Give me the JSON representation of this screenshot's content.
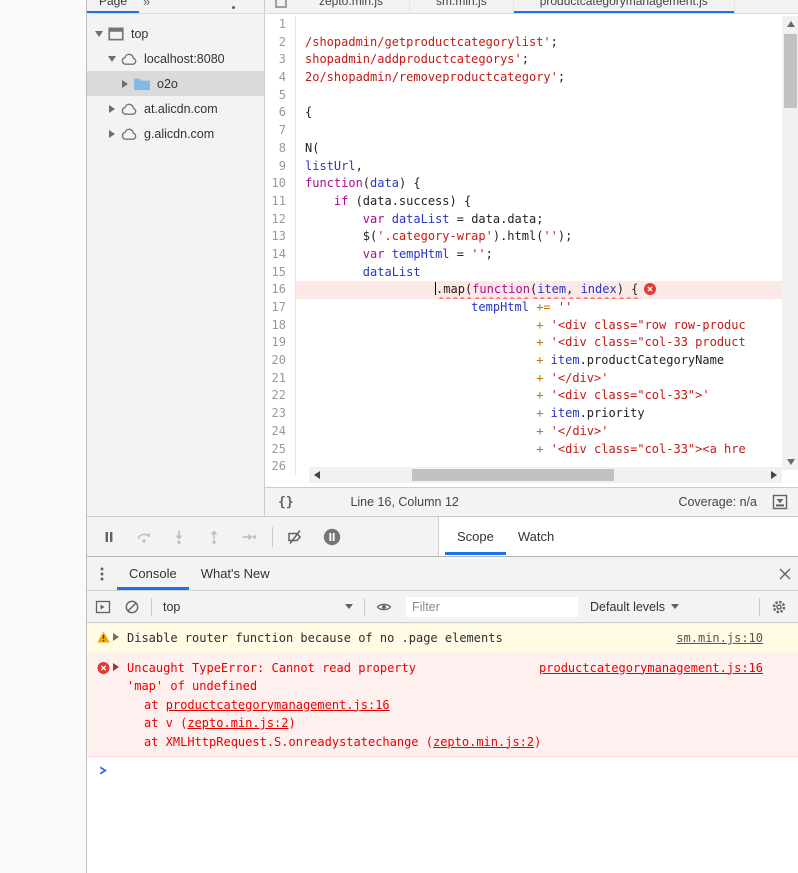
{
  "colors": {
    "accent_blue": "#1a73e8",
    "error_red": "#eb0000",
    "error_bg": "#fff0f0",
    "warning_bg": "#fffbe5",
    "selection_gray": "#dadada",
    "error_line_bg": "#fde8e8"
  },
  "navigator": {
    "tab_label": "Page",
    "overflow_label": "»",
    "more_icon": "kebab-menu-icon",
    "tree": [
      {
        "label": "top",
        "icon": "frame-icon",
        "arrow": "expanded",
        "depth": 0,
        "selected": false
      },
      {
        "label": "localhost:8080",
        "icon": "cloud-icon",
        "arrow": "expanded",
        "depth": 1,
        "selected": false
      },
      {
        "label": "o2o",
        "icon": "folder-icon",
        "arrow": "collapsed",
        "depth": 2,
        "selected": true
      },
      {
        "label": "at.alicdn.com",
        "icon": "cloud-icon",
        "arrow": "collapsed",
        "depth": 1,
        "selected": false
      },
      {
        "label": "g.alicdn.com",
        "icon": "cloud-icon",
        "arrow": "collapsed",
        "depth": 1,
        "selected": false
      }
    ]
  },
  "editor": {
    "tab_group_icon": "file-tab-icon",
    "tabs": [
      {
        "label": "zepto.min.js",
        "active": false
      },
      {
        "label": "sm.min.js",
        "active": false
      },
      {
        "label": "productcategorymanagement.js",
        "active": true
      }
    ],
    "status": {
      "pretty_print_label": "{}",
      "position": "Line 16, Column 12",
      "coverage": "Coverage: n/a",
      "drawer_icon": "expand-drawer-icon"
    },
    "code": {
      "lines": [
        {
          "n": 1,
          "seg": []
        },
        {
          "n": 2,
          "seg": [
            [
              "str",
              "/shopadmin/getproductcategorylist'"
            ],
            [
              "pln",
              ";"
            ]
          ]
        },
        {
          "n": 3,
          "seg": [
            [
              "str",
              "shopadmin/addproductcategorys'"
            ],
            [
              "pln",
              ";"
            ]
          ]
        },
        {
          "n": 4,
          "seg": [
            [
              "str",
              "2o/shopadmin/removeproductcategory'"
            ],
            [
              "pln",
              ";"
            ]
          ]
        },
        {
          "n": 5,
          "seg": []
        },
        {
          "n": 6,
          "seg": [
            [
              "pln",
              "{"
            ]
          ]
        },
        {
          "n": 7,
          "seg": []
        },
        {
          "n": 8,
          "seg": [
            [
              "pln",
              "N("
            ]
          ]
        },
        {
          "n": 9,
          "seg": [
            [
              "def",
              "listUrl"
            ],
            [
              "pln",
              ","
            ]
          ]
        },
        {
          "n": 10,
          "seg": [
            [
              "kw",
              "function"
            ],
            [
              "pln",
              "("
            ],
            [
              "def",
              "data"
            ],
            [
              "pln",
              ") {"
            ]
          ]
        },
        {
          "n": 11,
          "seg": [
            [
              "pln",
              "    "
            ],
            [
              "kw",
              "if"
            ],
            [
              "pln",
              " (data.success) {"
            ]
          ]
        },
        {
          "n": 12,
          "seg": [
            [
              "pln",
              "        "
            ],
            [
              "kw",
              "var"
            ],
            [
              "pln",
              " "
            ],
            [
              "def",
              "dataList"
            ],
            [
              "pln",
              " = data.data;"
            ]
          ]
        },
        {
          "n": 13,
          "seg": [
            [
              "pln",
              "        $("
            ],
            [
              "str",
              "'.category-wrap'"
            ],
            [
              "pln",
              ").html("
            ],
            [
              "str",
              "''"
            ],
            [
              "pln",
              ");"
            ]
          ]
        },
        {
          "n": 14,
          "seg": [
            [
              "pln",
              "        "
            ],
            [
              "kw",
              "var"
            ],
            [
              "pln",
              " "
            ],
            [
              "def",
              "tempHtml"
            ],
            [
              "pln",
              " = "
            ],
            [
              "str",
              "''"
            ],
            [
              "pln",
              ";"
            ]
          ]
        },
        {
          "n": 15,
          "seg": [
            [
              "pln",
              "        "
            ],
            [
              "def",
              "dataList"
            ]
          ]
        },
        {
          "n": 16,
          "error": true,
          "seg": [
            [
              "pln",
              "                  "
            ],
            [
              "caret",
              ""
            ],
            [
              "pln wavy",
              ".map("
            ],
            [
              "kw wavy",
              "function"
            ],
            [
              "pln wavy",
              "("
            ],
            [
              "def wavy",
              "item"
            ],
            [
              "pln wavy",
              ", "
            ],
            [
              "def wavy",
              "index"
            ],
            [
              "pln wavy",
              ") {"
            ],
            [
              "erricon",
              ""
            ]
          ]
        },
        {
          "n": 17,
          "seg": [
            [
              "pln",
              "                       "
            ],
            [
              "def",
              "tempHtml"
            ],
            [
              "pln",
              " "
            ],
            [
              "op",
              "+="
            ],
            [
              "pln",
              " "
            ],
            [
              "str",
              "''"
            ]
          ]
        },
        {
          "n": 18,
          "seg": [
            [
              "pln",
              "                                "
            ],
            [
              "op",
              "+"
            ],
            [
              "pln",
              " "
            ],
            [
              "str",
              "'<div class=\"row row-produc"
            ]
          ]
        },
        {
          "n": 19,
          "seg": [
            [
              "pln",
              "                                "
            ],
            [
              "op",
              "+"
            ],
            [
              "pln",
              " "
            ],
            [
              "str",
              "'<div class=\"col-33 product"
            ]
          ]
        },
        {
          "n": 20,
          "seg": [
            [
              "pln",
              "                                "
            ],
            [
              "op",
              "+"
            ],
            [
              "pln",
              " "
            ],
            [
              "def",
              "item"
            ],
            [
              "pln",
              ".productCategoryName"
            ]
          ]
        },
        {
          "n": 21,
          "seg": [
            [
              "pln",
              "                                "
            ],
            [
              "op",
              "+"
            ],
            [
              "pln",
              " "
            ],
            [
              "str",
              "'</div>'"
            ]
          ]
        },
        {
          "n": 22,
          "seg": [
            [
              "pln",
              "                                "
            ],
            [
              "op",
              "+"
            ],
            [
              "pln",
              " "
            ],
            [
              "str",
              "'<div class=\"col-33\">'"
            ]
          ]
        },
        {
          "n": 23,
          "seg": [
            [
              "pln",
              "                                "
            ],
            [
              "op",
              "+"
            ],
            [
              "pln",
              " "
            ],
            [
              "def",
              "item"
            ],
            [
              "pln",
              ".priority"
            ]
          ]
        },
        {
          "n": 24,
          "seg": [
            [
              "pln",
              "                                "
            ],
            [
              "op",
              "+"
            ],
            [
              "pln",
              " "
            ],
            [
              "str",
              "'</div>'"
            ]
          ]
        },
        {
          "n": 25,
          "seg": [
            [
              "pln",
              "                                "
            ],
            [
              "op",
              "+"
            ],
            [
              "pln",
              " "
            ],
            [
              "str",
              "'<div class=\"col-33\"><a hre"
            ]
          ]
        },
        {
          "n": 26,
          "seg": []
        }
      ]
    }
  },
  "debugger": {
    "controls": [
      {
        "name": "pause",
        "icon": "pause-icon",
        "enabled": true
      },
      {
        "name": "step-over",
        "icon": "step-over-icon",
        "enabled": false
      },
      {
        "name": "step-into",
        "icon": "step-into-icon",
        "enabled": false
      },
      {
        "name": "step-out",
        "icon": "step-out-icon",
        "enabled": false
      },
      {
        "name": "step",
        "icon": "step-icon",
        "enabled": false
      },
      {
        "name": "deactivate-breakpoints",
        "icon": "deactivate-breakpoints-icon",
        "enabled": true
      },
      {
        "name": "pause-on-exceptions",
        "icon": "pause-on-exceptions-icon",
        "enabled": true
      }
    ],
    "tabs": [
      {
        "label": "Scope",
        "active": true
      },
      {
        "label": "Watch",
        "active": false
      }
    ]
  },
  "console": {
    "tabs": [
      {
        "label": "Console",
        "active": true
      },
      {
        "label": "What's New",
        "active": false
      }
    ],
    "toolbar": {
      "context": "top",
      "filter_placeholder": "Filter",
      "levels": "Default levels"
    },
    "warning": {
      "text": "Disable router function because of no .page elements",
      "source_link": "sm.min.js:10"
    },
    "error": {
      "message_line1": "Uncaught TypeError: Cannot read property",
      "message_line2": "'map' of undefined",
      "source_link": "productcategorymanagement.js:16",
      "stack": [
        {
          "pre": "at ",
          "link": "productcategorymanagement.js:16",
          "post": ""
        },
        {
          "pre": "at v (",
          "link": "zepto.min.js:2",
          "post": ")"
        },
        {
          "pre": "at XMLHttpRequest.S.onreadystatechange (",
          "link": "zepto.min.js:2",
          "post": ")"
        }
      ]
    }
  }
}
